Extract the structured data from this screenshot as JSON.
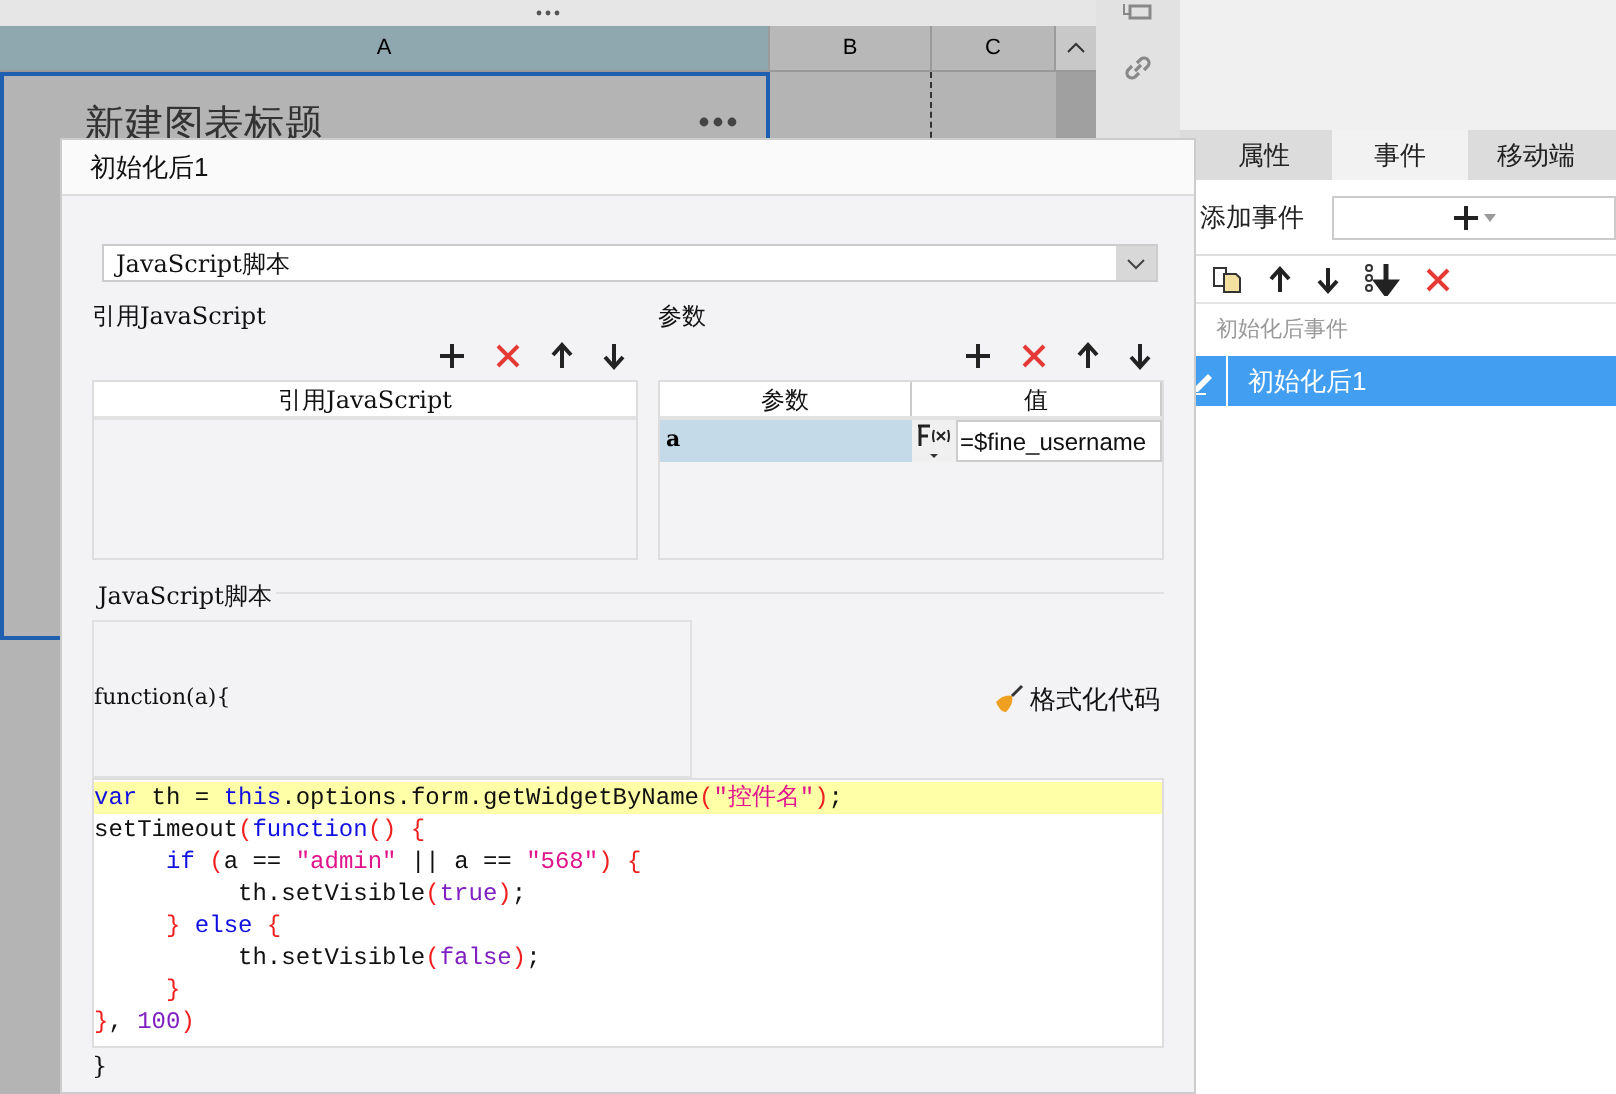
{
  "spreadsheet": {
    "columns": [
      {
        "label": "A",
        "selected": true
      },
      {
        "label": "B",
        "selected": false
      },
      {
        "label": "C",
        "selected": false
      }
    ],
    "chart_title": "新建图表标题"
  },
  "right_panel": {
    "tabs": [
      {
        "label": "属性",
        "selected": false
      },
      {
        "label": "事件",
        "selected": true
      },
      {
        "label": "移动端",
        "selected": false
      }
    ],
    "add_event_label": "添加事件",
    "group_label": "初始化后事件",
    "events": [
      {
        "label": "初始化后1",
        "selected": true
      }
    ]
  },
  "dialog": {
    "title": "初始化后1",
    "type_select": {
      "value": "JavaScript脚本"
    },
    "references": {
      "title": "引用JavaScript",
      "column": "引用JavaScript"
    },
    "parameters": {
      "title": "参数",
      "columns": [
        "参数",
        "值"
      ],
      "rows": [
        {
          "name": "a",
          "value": "=$fine_username",
          "selected": true
        }
      ]
    },
    "script": {
      "title": "JavaScript脚本",
      "header": "function(a){",
      "format_button": "格式化代码",
      "lines": [
        {
          "highlighted": true,
          "tokens": [
            {
              "kind": "keyword",
              "text": "var"
            },
            {
              "kind": "plain",
              "text": " th = "
            },
            {
              "kind": "keyword",
              "text": "this"
            },
            {
              "kind": "plain",
              "text": ".options.form.getWidgetByName"
            },
            {
              "kind": "bracket",
              "text": "("
            },
            {
              "kind": "string",
              "text": "\"控件名\""
            },
            {
              "kind": "bracket",
              "text": ")"
            },
            {
              "kind": "plain",
              "text": ";"
            }
          ]
        },
        {
          "highlighted": false,
          "tokens": [
            {
              "kind": "plain",
              "text": "setTimeout"
            },
            {
              "kind": "bracket",
              "text": "("
            },
            {
              "kind": "keyword",
              "text": "function"
            },
            {
              "kind": "bracket",
              "text": "() {"
            }
          ]
        },
        {
          "highlighted": false,
          "tokens": [
            {
              "kind": "keyword",
              "text": "     if"
            },
            {
              "kind": "bracket",
              "text": " ("
            },
            {
              "kind": "plain",
              "text": "a == "
            },
            {
              "kind": "string",
              "text": "\"admin\""
            },
            {
              "kind": "plain",
              "text": " || a == "
            },
            {
              "kind": "string",
              "text": "\"568\""
            },
            {
              "kind": "bracket",
              "text": ") {"
            }
          ]
        },
        {
          "highlighted": false,
          "tokens": [
            {
              "kind": "plain",
              "text": "          th.setVisible"
            },
            {
              "kind": "bracket",
              "text": "("
            },
            {
              "kind": "literal",
              "text": "true"
            },
            {
              "kind": "bracket",
              "text": ")"
            },
            {
              "kind": "plain",
              "text": ";"
            }
          ]
        },
        {
          "highlighted": false,
          "tokens": [
            {
              "kind": "bracket",
              "text": "     }"
            },
            {
              "kind": "keyword",
              "text": " else"
            },
            {
              "kind": "bracket",
              "text": " {"
            }
          ]
        },
        {
          "highlighted": false,
          "tokens": [
            {
              "kind": "plain",
              "text": "          th.setVisible"
            },
            {
              "kind": "bracket",
              "text": "("
            },
            {
              "kind": "literal",
              "text": "false"
            },
            {
              "kind": "bracket",
              "text": ")"
            },
            {
              "kind": "plain",
              "text": ";"
            }
          ]
        },
        {
          "highlighted": false,
          "tokens": [
            {
              "kind": "bracket",
              "text": "     }"
            }
          ]
        },
        {
          "highlighted": false,
          "tokens": [
            {
              "kind": "bracket",
              "text": "}"
            },
            {
              "kind": "plain",
              "text": ", "
            },
            {
              "kind": "literal",
              "text": "100"
            },
            {
              "kind": "bracket",
              "text": ")"
            }
          ]
        }
      ],
      "footer": "}"
    }
  }
}
